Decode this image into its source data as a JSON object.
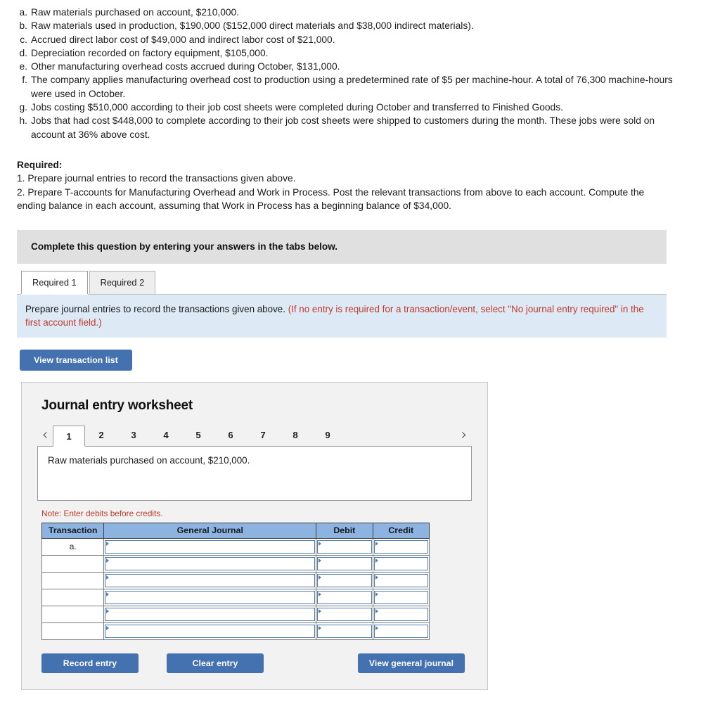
{
  "problem": {
    "items": [
      {
        "letter": "a.",
        "text": "Raw materials purchased on account, $210,000."
      },
      {
        "letter": "b.",
        "text": "Raw materials used in production, $190,000 ($152,000 direct materials and $38,000 indirect materials)."
      },
      {
        "letter": "c.",
        "text": "Accrued direct labor cost of $49,000 and indirect labor cost of $21,000."
      },
      {
        "letter": "d.",
        "text": "Depreciation recorded on factory equipment, $105,000."
      },
      {
        "letter": "e.",
        "text": "Other manufacturing overhead costs accrued during October, $131,000."
      },
      {
        "letter": "f.",
        "text": "The company applies manufacturing overhead cost to production using a predetermined rate of $5 per machine-hour. A total of 76,300 machine-hours were used in October."
      },
      {
        "letter": "g.",
        "text": "Jobs costing $510,000 according to their job cost sheets were completed during October and transferred to Finished Goods."
      },
      {
        "letter": "h.",
        "text": "Jobs that had cost $448,000 to complete according to their job cost sheets were shipped to customers during the month. These jobs were sold on account at 36% above cost."
      }
    ]
  },
  "required": {
    "title": "Required:",
    "line1": "1. Prepare journal entries to record the transactions given above.",
    "line2": "2. Prepare T-accounts for Manufacturing Overhead and Work in Process. Post the relevant transactions from above to each account. Compute the ending balance in each account, assuming that Work in Process has a beginning balance of $34,000."
  },
  "banner": {
    "text": "Complete this question by entering your answers in the tabs below."
  },
  "tabs": [
    {
      "label": "Required 1",
      "active": true
    },
    {
      "label": "Required 2",
      "active": false
    }
  ],
  "instruction": {
    "black": "Prepare journal entries to record the transactions given above.",
    "red": "(If no entry is required for a transaction/event, select \"No journal entry required\" in the first account field.)"
  },
  "buttons": {
    "view_transaction_list": "View transaction list",
    "record_entry": "Record entry",
    "clear_entry": "Clear entry",
    "view_general_journal": "View general journal"
  },
  "worksheet": {
    "title": "Journal entry worksheet",
    "pager": {
      "prev_icon": "‹",
      "next_icon": "›",
      "pages": [
        "1",
        "2",
        "3",
        "4",
        "5",
        "6",
        "7",
        "8",
        "9"
      ],
      "active_page": "1"
    },
    "transaction_description": "Raw materials purchased on account, $210,000.",
    "note": "Note: Enter debits before credits.",
    "table": {
      "headers": [
        "Transaction",
        "General Journal",
        "Debit",
        "Credit"
      ],
      "rows": [
        {
          "transaction": "a.",
          "general_journal": "",
          "debit": "",
          "credit": ""
        },
        {
          "transaction": "",
          "general_journal": "",
          "debit": "",
          "credit": ""
        },
        {
          "transaction": "",
          "general_journal": "",
          "debit": "",
          "credit": ""
        },
        {
          "transaction": "",
          "general_journal": "",
          "debit": "",
          "credit": ""
        },
        {
          "transaction": "",
          "general_journal": "",
          "debit": "",
          "credit": ""
        },
        {
          "transaction": "",
          "general_journal": "",
          "debit": "",
          "credit": ""
        }
      ]
    }
  },
  "colors": {
    "accent_blue": "#4472b0",
    "table_header_blue": "#8db3e0",
    "instruction_panel_blue": "#ddeaf6",
    "banner_grey": "#e0e0e0",
    "red_text": "#c0392b"
  }
}
